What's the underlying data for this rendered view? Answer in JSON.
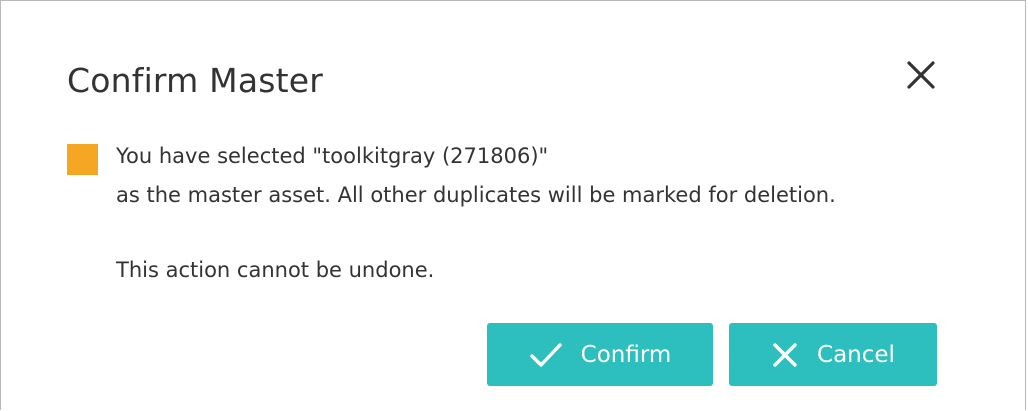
{
  "dialog": {
    "title": "Confirm Master",
    "message_line1": "You have selected \"toolkitgray (271806)\"",
    "message_line2": "as the master asset. All other duplicates will be marked for deletion.",
    "message_line3": "This action cannot be undone.",
    "close_icon": "close-icon",
    "marker_color": "#f5a623",
    "confirm_label": "Confirm",
    "confirm_icon": "checkmark-icon",
    "cancel_label": "Cancel",
    "cancel_icon": "x-icon",
    "button_color": "#2dbfbd"
  }
}
